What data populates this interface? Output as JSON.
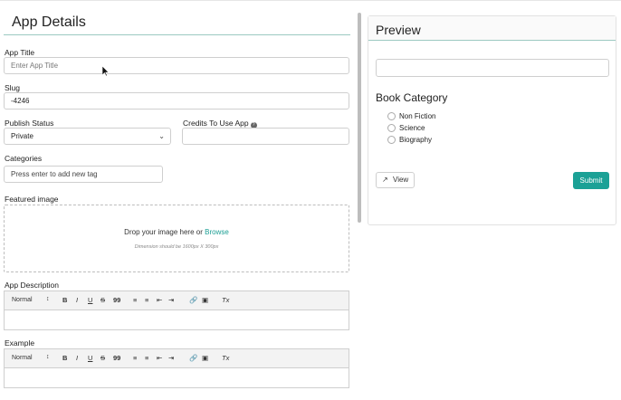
{
  "form": {
    "title": "App Details",
    "app_title": {
      "label": "App Title",
      "placeholder": "Enter App Title"
    },
    "slug": {
      "label": "Slug",
      "value": "-4246"
    },
    "publish_status": {
      "label": "Publish Status",
      "value": "Private"
    },
    "credits": {
      "label": "Credits To Use App",
      "value": ""
    },
    "categories": {
      "label": "Categories",
      "placeholder": "Press enter to add new tag"
    },
    "featured_image": {
      "label": "Featured image",
      "drop_text": "Drop your image here or",
      "browse": "Browse",
      "dimension_hint": "Dimension should be 1600px X 300px"
    },
    "app_description": {
      "label": "App Description"
    },
    "example": {
      "label": "Example"
    },
    "toolbar": {
      "normal": "Normal",
      "bold": "B",
      "italic": "I",
      "underline": "U",
      "strike": "S",
      "quote": "99",
      "clear": "Tx"
    }
  },
  "preview": {
    "title": "Preview",
    "category_label": "Book Category",
    "options": [
      "Non Fiction",
      "Science",
      "Biography"
    ],
    "view_button": "View",
    "submit_button": "Submit"
  },
  "colors": {
    "accent": "#1ba196",
    "rule": "#9cc9c1"
  }
}
